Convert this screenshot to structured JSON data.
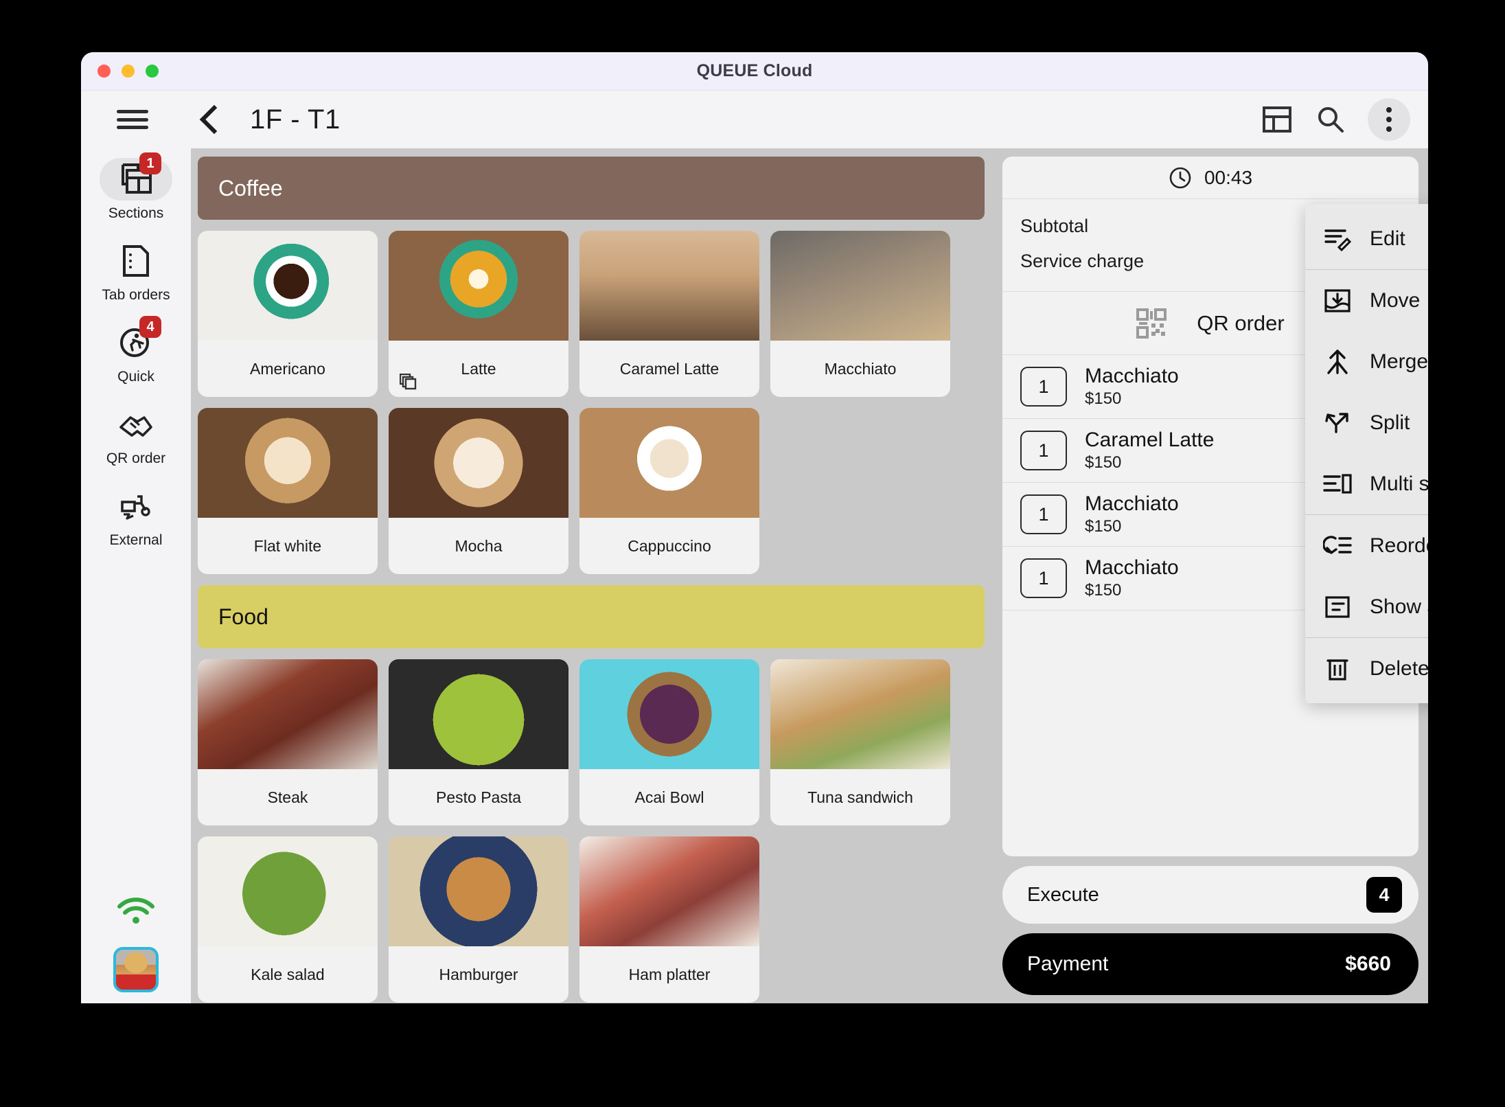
{
  "window": {
    "title": "QUEUE Cloud",
    "traffic_lights": [
      "close",
      "minimize",
      "maximize"
    ]
  },
  "header": {
    "menu_icon": "hamburger-icon",
    "back_icon": "back-chevron-icon",
    "page_title": "1F - T1",
    "layout_icon": "layout-icon",
    "search_icon": "search-icon",
    "more_icon": "three-dots-vertical-icon"
  },
  "sidebar": {
    "items": [
      {
        "label": "Sections",
        "icon": "sections-icon",
        "badge": "1",
        "active": true
      },
      {
        "label": "Tab orders",
        "icon": "document-icon",
        "badge": null,
        "active": false
      },
      {
        "label": "Quick",
        "icon": "runner-icon",
        "badge": "4",
        "active": false
      },
      {
        "label": "QR order",
        "icon": "handshake-icon",
        "badge": null,
        "active": false
      },
      {
        "label": "External",
        "icon": "scooter-icon",
        "badge": null,
        "active": false
      }
    ],
    "status": {
      "wifi_icon": "wifi-icon",
      "wifi_color": "#35a83f"
    },
    "avatar": {
      "name": "user-avatar",
      "border_color": "#2bb8dd"
    }
  },
  "menu": {
    "sections": [
      {
        "name": "Coffee",
        "color": "#81675c",
        "text_color": "#ffffff",
        "items": [
          {
            "label": "Americano",
            "photo": "ph-americano",
            "stacked": false
          },
          {
            "label": "Latte",
            "photo": "ph-latte",
            "stacked": true
          },
          {
            "label": "Caramel Latte",
            "photo": "ph-caramel",
            "stacked": false
          },
          {
            "label": "Macchiato",
            "photo": "ph-macchiato",
            "stacked": false
          },
          {
            "label": "Flat white",
            "photo": "ph-flatwhite",
            "stacked": false
          },
          {
            "label": "Mocha",
            "photo": "ph-mocha",
            "stacked": false
          },
          {
            "label": "Cappuccino",
            "photo": "ph-cappuccino",
            "stacked": false
          }
        ]
      },
      {
        "name": "Food",
        "color": "#d8cf64",
        "text_color": "#111111",
        "items": [
          {
            "label": "Steak",
            "photo": "ph-steak",
            "stacked": false
          },
          {
            "label": "Pesto Pasta",
            "photo": "ph-pesto",
            "stacked": false
          },
          {
            "label": "Acai Bowl",
            "photo": "ph-acai",
            "stacked": false
          },
          {
            "label": "Tuna sandwich",
            "photo": "ph-tuna",
            "stacked": false
          },
          {
            "label": "Kale salad",
            "photo": "ph-kale",
            "stacked": false
          },
          {
            "label": "Hamburger",
            "photo": "ph-hamburger",
            "stacked": false
          },
          {
            "label": "Ham platter",
            "photo": "ph-ham",
            "stacked": false
          }
        ]
      }
    ]
  },
  "order": {
    "timer": "00:43",
    "timer_icon": "clock-icon",
    "totals": [
      {
        "label": "Subtotal",
        "value": ""
      },
      {
        "label": "Service charge",
        "value": ""
      }
    ],
    "qr_row": {
      "label": "QR order",
      "icon": "qr-code-icon"
    },
    "line_items": [
      {
        "qty": "1",
        "name": "Macchiato",
        "price": "$150"
      },
      {
        "qty": "1",
        "name": "Caramel Latte",
        "price": "$150"
      },
      {
        "qty": "1",
        "name": "Macchiato",
        "price": "$150"
      },
      {
        "qty": "1",
        "name": "Macchiato",
        "price": "$150"
      }
    ],
    "execute": {
      "label": "Execute",
      "count": "4"
    },
    "payment": {
      "label": "Payment",
      "amount": "$660"
    }
  },
  "dropdown": {
    "items": [
      {
        "label": "Edit",
        "icon": "edit-icon",
        "separator_after": true
      },
      {
        "label": "Move",
        "icon": "move-icon",
        "separator_after": false
      },
      {
        "label": "Merge",
        "icon": "merge-icon",
        "separator_after": false
      },
      {
        "label": "Split",
        "icon": "split-icon",
        "separator_after": false
      },
      {
        "label": "Multi split",
        "icon": "multi-split-icon",
        "separator_after": true
      },
      {
        "label": "Reorder cart",
        "icon": "reorder-cart-icon",
        "separator_after": false
      },
      {
        "label": "Show activities",
        "icon": "show-activities-icon",
        "separator_after": true
      },
      {
        "label": "Delete",
        "icon": "delete-icon",
        "separator_after": false
      }
    ]
  }
}
